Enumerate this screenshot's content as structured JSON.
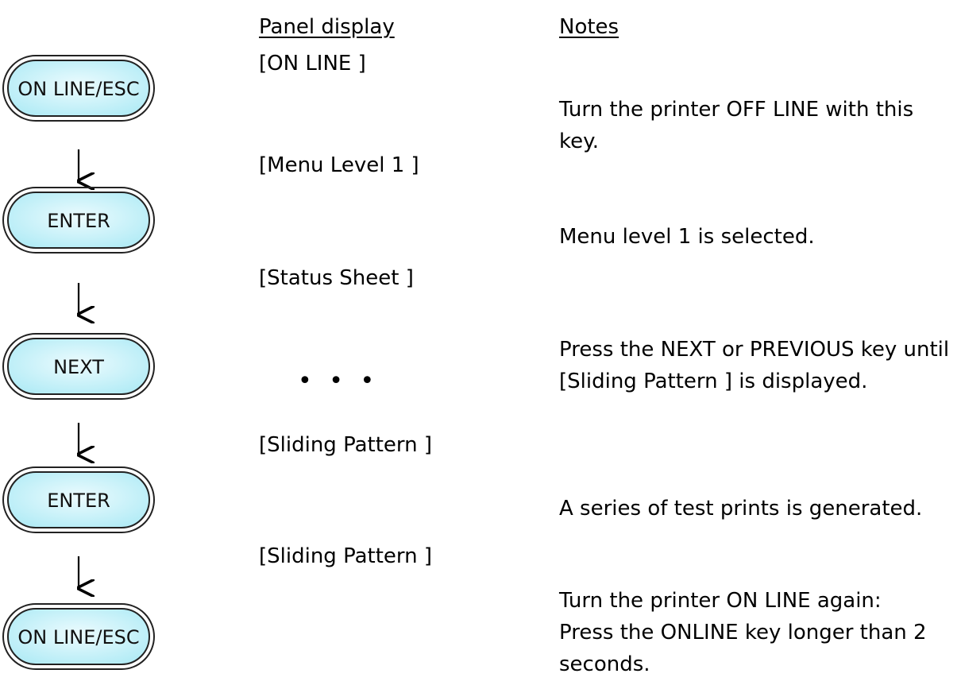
{
  "headers": {
    "panel_display": "Panel display",
    "notes": "Notes"
  },
  "keys": [
    {
      "label": "ON LINE/ESC"
    },
    {
      "label": "ENTER"
    },
    {
      "label": "NEXT"
    },
    {
      "label": "ENTER"
    },
    {
      "label": "ON LINE/ESC"
    }
  ],
  "panel_display": [
    "[ON LINE ]",
    "[Menu Level 1 ]",
    "[Status Sheet ]",
    "• • •",
    "[Sliding Pattern ]",
    "[Sliding Pattern ]"
  ],
  "notes": [
    "Turn the printer OFF LINE with this key.",
    "Menu level 1 is selected.",
    "Press the NEXT or PREVIOUS key until [Sliding Pattern ] is displayed.",
    "A series of test prints is generated.",
    "Turn the printer ON LINE again: Press the ONLINE key longer than 2 seconds."
  ],
  "colors": {
    "key_fill_light": "#ecfbfe",
    "key_fill_dark": "#b4ecf6",
    "key_outline": "#222222",
    "arrow": "#000000"
  },
  "icons": {
    "flow_arrow": "arrow-down-icon"
  }
}
